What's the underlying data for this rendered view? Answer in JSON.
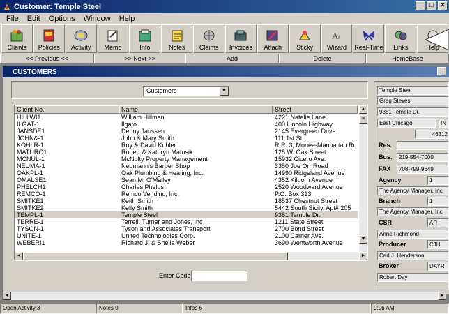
{
  "window": {
    "title": "Customer: Temple Steel",
    "controls": [
      "_",
      "□",
      "×"
    ]
  },
  "menu": [
    "File",
    "Edit",
    "Options",
    "Window",
    "Help"
  ],
  "toolbar": [
    {
      "label": "Clients",
      "icon": "clients-icon"
    },
    {
      "label": "Policies",
      "icon": "policies-icon"
    },
    {
      "label": "Activity",
      "icon": "activity-icon"
    },
    {
      "label": "Memo",
      "icon": "memo-icon"
    },
    {
      "label": "Info",
      "icon": "info-icon"
    },
    {
      "label": "Notes",
      "icon": "notes-icon"
    },
    {
      "label": "Claims",
      "icon": "claims-icon"
    },
    {
      "label": "Invoices",
      "icon": "invoices-icon"
    },
    {
      "label": "Attach",
      "icon": "attach-icon"
    },
    {
      "label": "Sticky",
      "icon": "sticky-icon"
    },
    {
      "label": "Wizard",
      "icon": "wizard-icon"
    },
    {
      "label": "Real-Time",
      "icon": "butterfly-icon"
    },
    {
      "label": "Links",
      "icon": "links-icon"
    },
    {
      "label": "Help",
      "icon": "help-icon"
    }
  ],
  "nav": {
    "previous": "<< Previous <<",
    "next": ">> Next >>",
    "add": "Add",
    "delete": "Delete",
    "homebase": "HomeBase"
  },
  "child": {
    "title": "CUSTOMERS"
  },
  "filter": {
    "selected": "Customers"
  },
  "list": {
    "headers": [
      "Client No.",
      "Name",
      "Street"
    ],
    "rows": [
      [
        "HILLWI1",
        "William Hillman",
        "4221 Natalie Lane"
      ],
      [
        "ILGAT-1",
        "Ilgato",
        "400 Lincoln Highway"
      ],
      [
        "JANSDE1",
        "Denny Janssen",
        "2145 Evergreen Drive"
      ],
      [
        "JOHN&-1",
        "John & Mary Smith",
        "111 1st St"
      ],
      [
        "KOHLR-1",
        "Roy & David Kohler",
        "R.R. 3, Monee-Manhattan Rd"
      ],
      [
        "MATURO1",
        "Robert & Kathryn Matusik",
        "125 W. Oak Street"
      ],
      [
        "MCNUL-1",
        "McNulty Property Management",
        "15932 Cicero Ave."
      ],
      [
        "NEUMA-1",
        "Neumann's Barber Shop",
        "3350 Joe Orr Road"
      ],
      [
        "OAKPL-1",
        "Oak Plumbing & Heating, Inc.",
        "14990 Ridgeland Avenue"
      ],
      [
        "OMALSE1",
        "Sean M. O'Malley",
        "4352 Kilborn Avenue"
      ],
      [
        "PHELCH1",
        "Charles Phelps",
        "2520 Woodward Avenue"
      ],
      [
        "REMCO-1",
        "Remco Vending, Inc.",
        "P.O. Box 313"
      ],
      [
        "SMITKE1",
        "Keith Smith",
        "18537 Chestnut Street"
      ],
      [
        "SMITKE2",
        "Kelly Smith",
        "5442 South Sicily, Apt# 205"
      ],
      [
        "TEMPL-1",
        "Temple Steel",
        "9381 Temple Dr."
      ],
      [
        "TERRE-1",
        "Terrell, Turner and Jones, Inc",
        "1211 State Street"
      ],
      [
        "TYSON-1",
        "Tyson and Associates Transport",
        "2700 Bond Street"
      ],
      [
        "UNITE-1",
        "United Technologies Corp.",
        "2100 Carrier Ave."
      ],
      [
        "WEBERI1",
        "Richard J. & Sheila Weber",
        "3690 Wentworth Avenue"
      ]
    ],
    "selected_index": 14
  },
  "entercode": {
    "label": "Enter Code",
    "value": ""
  },
  "detail": {
    "name": "Temple Steel",
    "contact": "Greg Steves",
    "address": "9381 Temple Dr.",
    "city": "East Chicago",
    "state": "IN",
    "zip": "46312",
    "res_label": "Res.",
    "res_value": "",
    "bus_label": "Bus.",
    "bus_value": "219-554-7000",
    "fax_label": "FAX",
    "fax_value": "708-799-9649",
    "agency_label": "Agency",
    "agency_code": "1",
    "agency_name": "The Agency Manager, Inc",
    "branch_label": "Branch",
    "branch_code": "1",
    "branch_name": "The Agency Manager, Inc",
    "csr_label": "CSR",
    "csr_code": "AR",
    "csr_name": "Anne Richmond",
    "producer_label": "Producer",
    "producer_code": "CJH",
    "producer_name": "Carl J. Henderson",
    "broker_label": "Broker",
    "broker_code": "DAYR",
    "broker_name": "Robert Day"
  },
  "status": {
    "activity": "Open Activity 3",
    "notes": "Notes 0",
    "infos": "Infos 6",
    "time": "9:06 AM"
  }
}
